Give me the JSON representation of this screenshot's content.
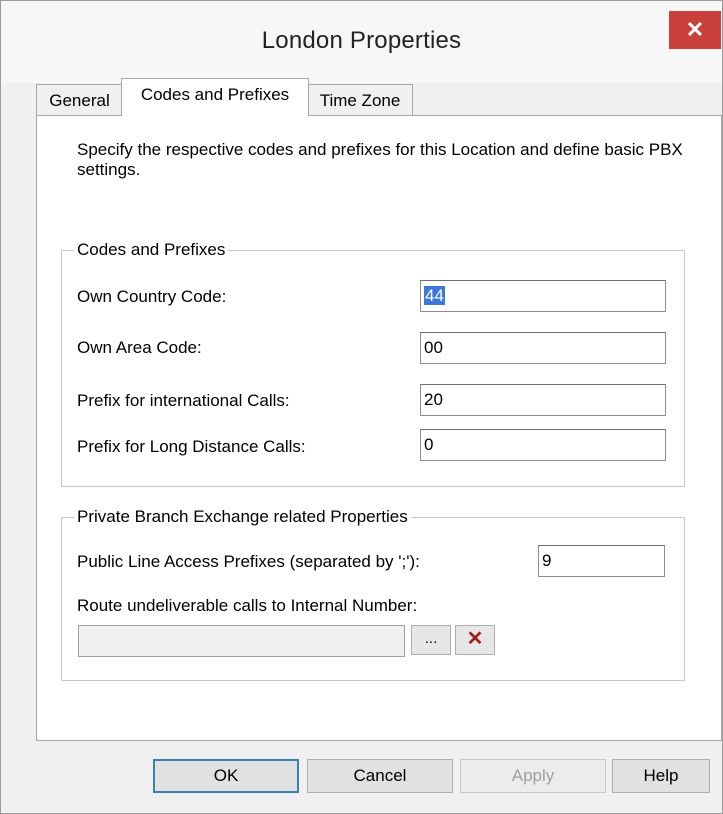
{
  "window": {
    "title": "London Properties",
    "close_glyph": "✕"
  },
  "tabs": [
    {
      "label": "General"
    },
    {
      "label": "Codes and Prefixes"
    },
    {
      "label": "Time Zone"
    }
  ],
  "description": "Specify the respective codes and prefixes for this Location and define basic PBX settings.",
  "codes_group": {
    "label": "Codes and Prefixes",
    "own_country_code": {
      "label": "Own Country Code:",
      "value": "44"
    },
    "own_area_code": {
      "label": "Own Area Code:",
      "value": "00"
    },
    "prefix_international": {
      "label": "Prefix for international Calls:",
      "value": "20"
    },
    "prefix_long_distance": {
      "label": "Prefix for Long Distance Calls:",
      "value": "0"
    }
  },
  "pbx_group": {
    "label": "Private Branch Exchange related Properties",
    "public_line_access": {
      "label": "Public Line Access Prefixes (separated by ';'):",
      "value": "9"
    },
    "route_undeliverable": {
      "label": "Route undeliverable calls to Internal Number:",
      "value": ""
    },
    "browse_label": "...",
    "clear_glyph": "✕",
    "clear_color": "#a51d1d"
  },
  "buttons": {
    "ok": "OK",
    "cancel": "Cancel",
    "apply": "Apply",
    "help": "Help"
  },
  "colors": {
    "close_button": "#c9413a",
    "selection": "#3c78d8",
    "default_button_border": "#3c7fb1"
  }
}
